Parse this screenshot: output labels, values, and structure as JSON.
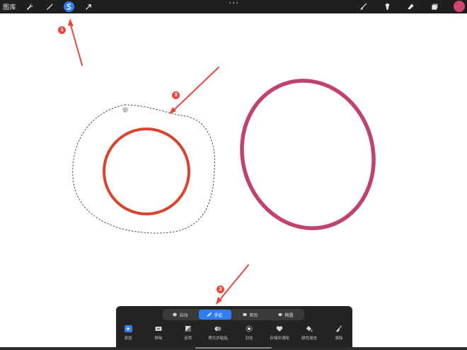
{
  "toolbar": {
    "gallery_label": "图库",
    "left_tools": [
      {
        "icon": "wrench-icon"
      },
      {
        "icon": "magic-wand-icon"
      },
      {
        "icon": "selection-icon",
        "active": true
      },
      {
        "icon": "transform-arrow-icon"
      }
    ],
    "right_tools": [
      {
        "icon": "brush-icon"
      },
      {
        "icon": "smudge-icon"
      },
      {
        "icon": "eraser-icon"
      },
      {
        "icon": "layers-icon"
      }
    ],
    "current_color": "#d3436e",
    "accent": "#2f7ef6"
  },
  "annotations": [
    "1",
    "2",
    "3"
  ],
  "selection_panel": {
    "modes": [
      {
        "label": "自动",
        "active": false
      },
      {
        "label": "手绘",
        "active": true
      },
      {
        "label": "矩形",
        "active": false
      },
      {
        "label": "椭圆",
        "active": false
      }
    ],
    "actions": [
      {
        "label": "添加",
        "icon": "add-icon"
      },
      {
        "label": "移除",
        "icon": "remove-icon"
      },
      {
        "label": "反转",
        "icon": "invert-icon"
      },
      {
        "label": "拷贝并粘贴",
        "icon": "copy-paste-icon"
      },
      {
        "label": "羽化",
        "icon": "feather-icon"
      },
      {
        "label": "存储并清除",
        "icon": "save-clear-icon"
      },
      {
        "label": "颜色填充",
        "icon": "color-fill-icon"
      },
      {
        "label": "清除",
        "icon": "clear-icon"
      }
    ]
  },
  "canvas": {
    "red_circle_color": "#d9442c",
    "pink_ellipse_color": "#c04270",
    "arrow_color": "#e8473b"
  }
}
